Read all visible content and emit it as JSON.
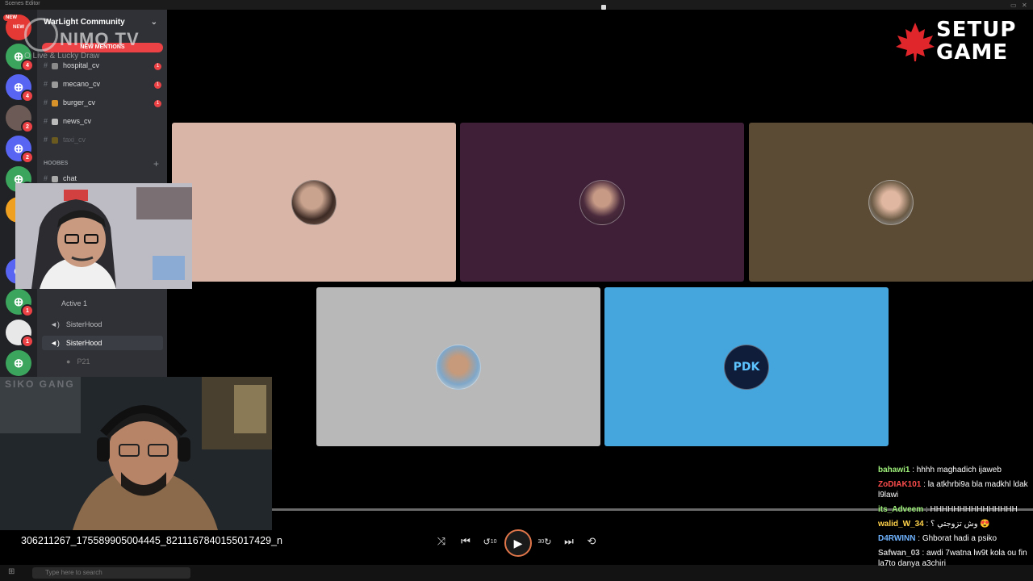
{
  "window": {
    "title": "Scenes Editor"
  },
  "logo": {
    "line1": "SETUP",
    "line2": "GAME",
    "accent": "#e0252b"
  },
  "watermark": {
    "brand": "NIMO TV",
    "tagline": "O Live & Lucky Draw",
    "new_tag": "NEW"
  },
  "discord": {
    "server_name": "WarLight Community",
    "new_mentions": "NEW MENTIONS",
    "channels": [
      {
        "name": "hospital_cv",
        "count": "1"
      },
      {
        "name": "mecano_cv",
        "count": "1"
      },
      {
        "name": "burger_cv",
        "count": "1"
      },
      {
        "name": "news_cv",
        "count": ""
      },
      {
        "name": "taxi_cv",
        "count": ""
      }
    ],
    "category": "HOOBES",
    "chat_channel": "chat",
    "voice_header": "Active 1",
    "voice_users": [
      "SisterHood",
      "SisterHood",
      "P21"
    ],
    "server_badges": [
      "4",
      "4",
      "2",
      "2",
      "4",
      "",
      "2",
      "1",
      "1"
    ]
  },
  "tiles": [
    {
      "color": "#d9b5a7"
    },
    {
      "color": "#3e1f37"
    },
    {
      "color": "#5b4a34"
    },
    {
      "color": "#b8b8b8"
    },
    {
      "color": "#45a6dd",
      "avatar_text": "PDK"
    }
  ],
  "webcam_text": "SIKO GANG",
  "player": {
    "filename": "306211267_175589905004445_8211167840155017429_n",
    "skip_back_label": "10",
    "skip_fwd_label": "30",
    "progress": 0.0
  },
  "taskbar": {
    "search_placeholder": "Type here to search"
  },
  "chat": [
    {
      "user": "bahawi1",
      "color": "#9ef07a",
      "text": ": hhhh maghadich ijaweb"
    },
    {
      "user": "ZoDIAK101",
      "color": "#ff4d4d",
      "text": ": la atkhrbi9a bla madkhl ldak l9lawi"
    },
    {
      "user": "its_Adveem",
      "color": "#9ef07a",
      "text": ": HHHHHHHHHHHHHHH"
    },
    {
      "user": "walid_W_34",
      "color": "#ffd24a",
      "text": ": وش تزوجتي ؟ 😍"
    },
    {
      "user": "D4RWINN",
      "color": "#6fb3ff",
      "text": ": Ghborat hadi a psiko"
    },
    {
      "user": "Safwan_03",
      "color": "#c9c9c9",
      "text": ": awdi 7watna lw9t kola ou fin la7to danya a3chiri"
    }
  ]
}
